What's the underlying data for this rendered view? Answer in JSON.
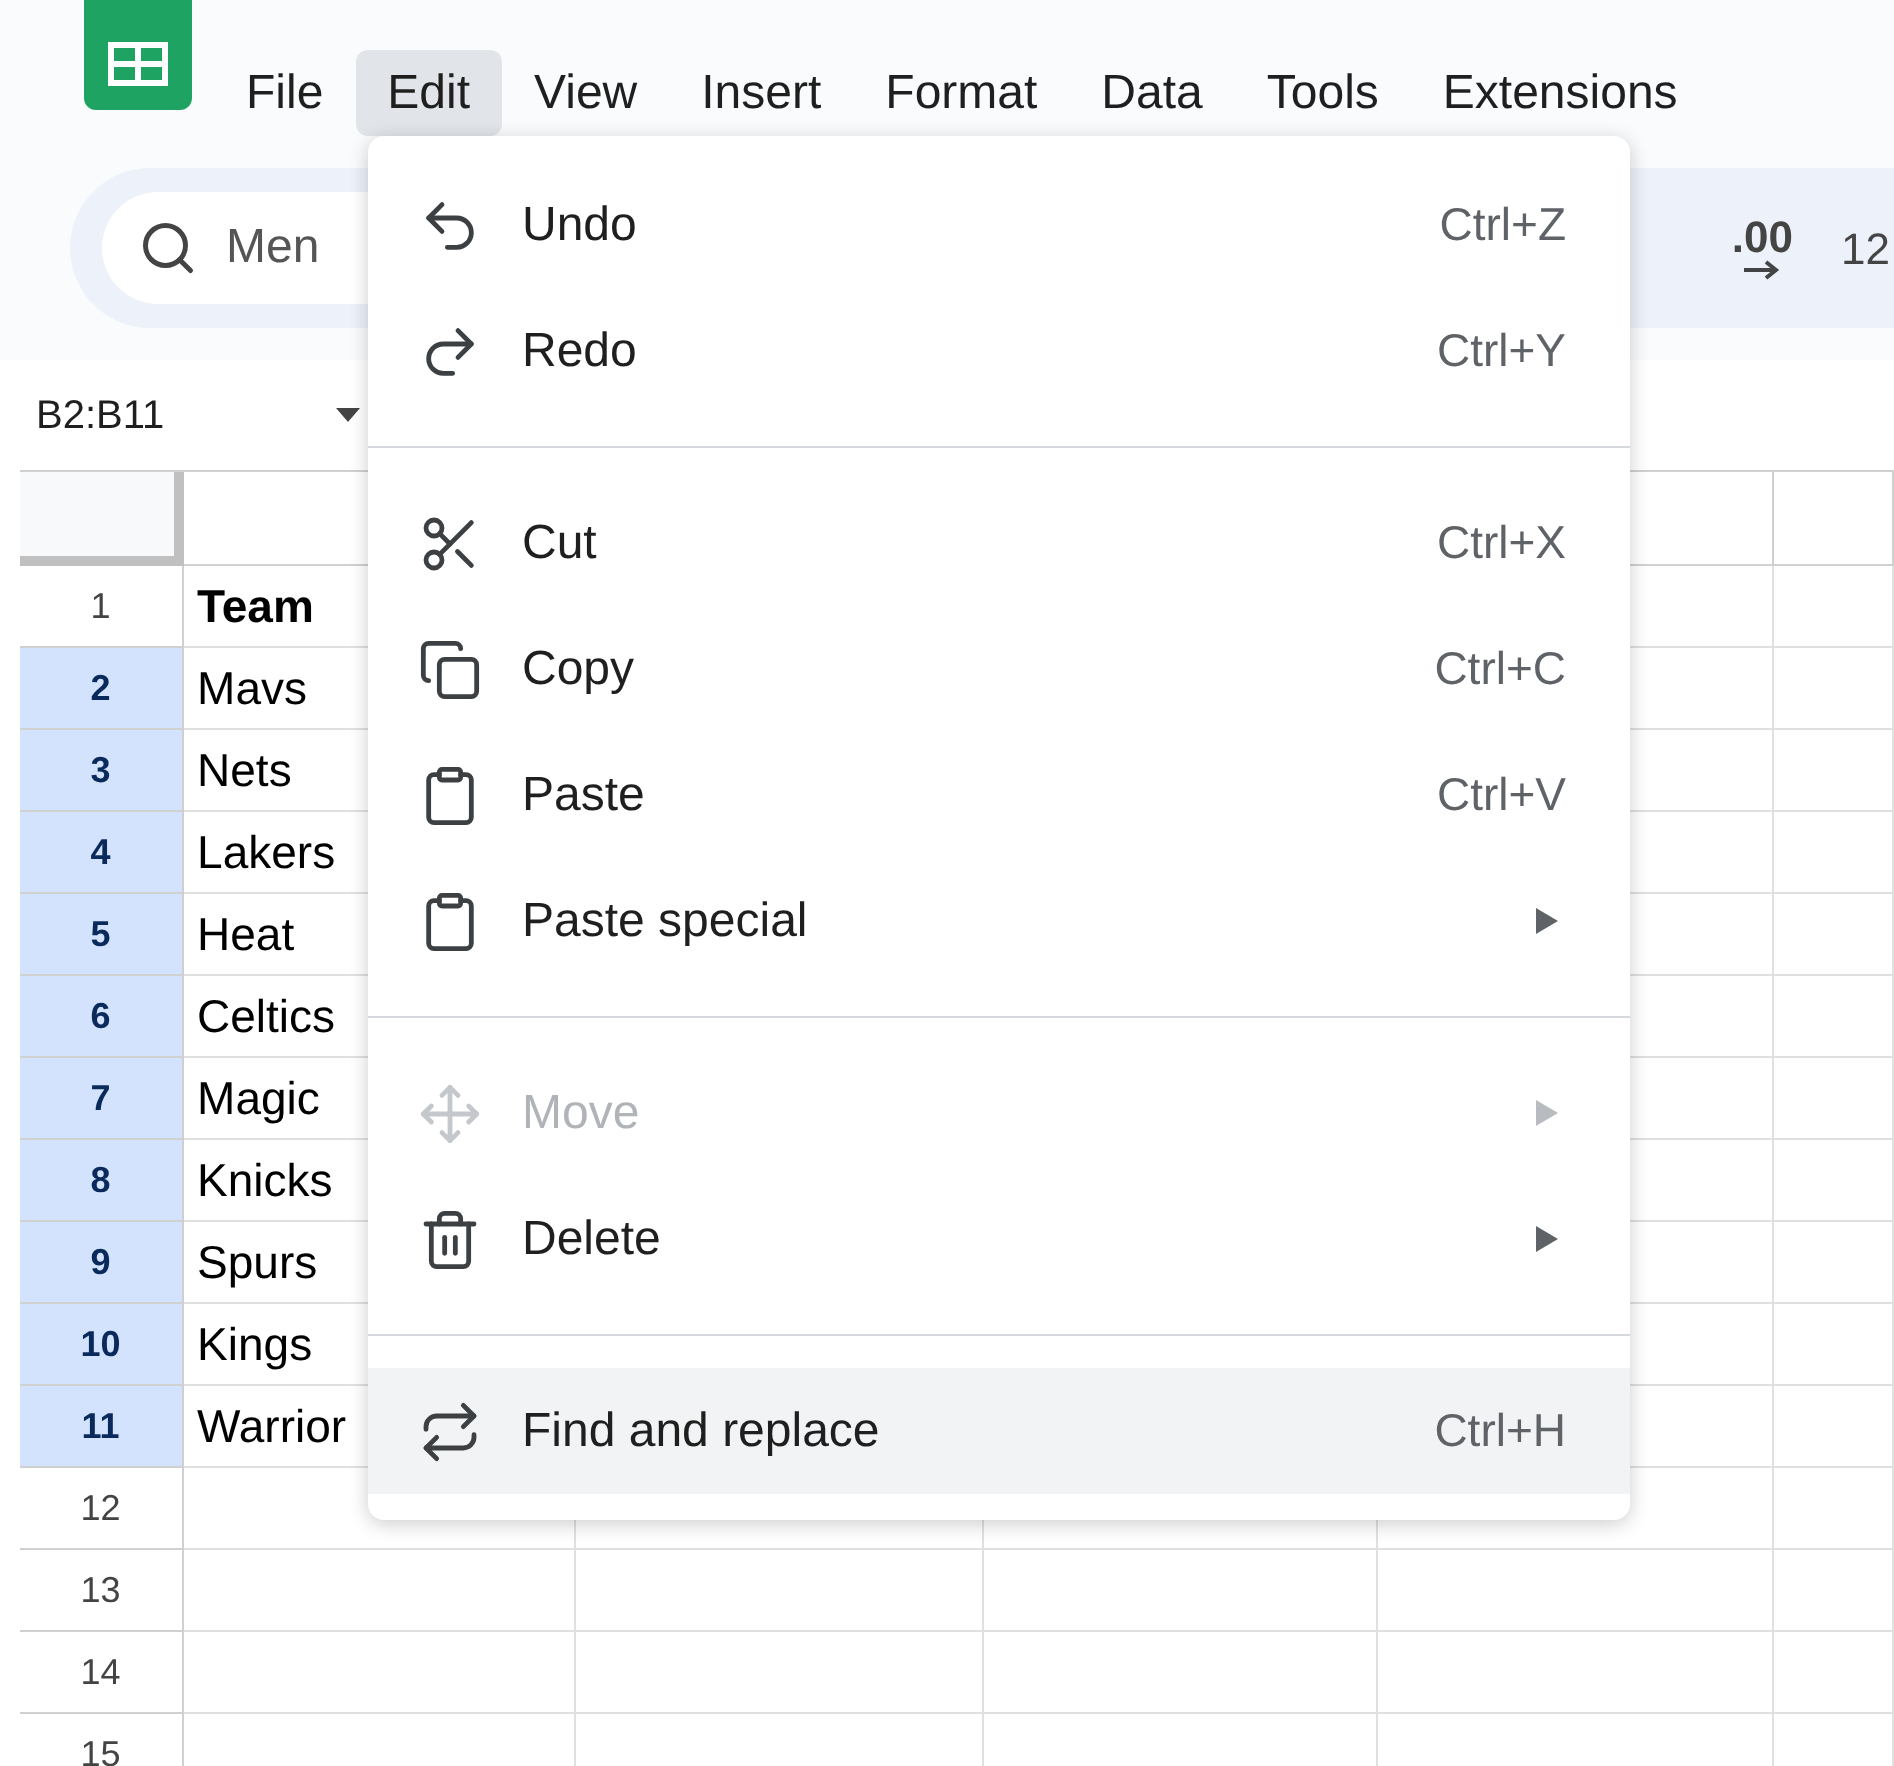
{
  "menu_bar": [
    {
      "label": "File",
      "selected": false
    },
    {
      "label": "Edit",
      "selected": true
    },
    {
      "label": "View",
      "selected": false
    },
    {
      "label": "Insert",
      "selected": false
    },
    {
      "label": "Format",
      "selected": false
    },
    {
      "label": "Data",
      "selected": false
    },
    {
      "label": "Tools",
      "selected": false
    },
    {
      "label": "Extensions",
      "selected": false
    }
  ],
  "toolbar": {
    "search_placeholder": "Men",
    "decimal_icon": ".00",
    "format_partial": "12"
  },
  "name_box": "B2:B11",
  "rows": [
    {
      "number": "1",
      "selected": false,
      "cell": "Team",
      "bold": true
    },
    {
      "number": "2",
      "selected": true,
      "cell": "Mavs",
      "bold": false
    },
    {
      "number": "3",
      "selected": true,
      "cell": "Nets",
      "bold": false
    },
    {
      "number": "4",
      "selected": true,
      "cell": "Lakers",
      "bold": false
    },
    {
      "number": "5",
      "selected": true,
      "cell": "Heat",
      "bold": false
    },
    {
      "number": "6",
      "selected": true,
      "cell": "Celtics",
      "bold": false
    },
    {
      "number": "7",
      "selected": true,
      "cell": "Magic",
      "bold": false
    },
    {
      "number": "8",
      "selected": true,
      "cell": "Knicks",
      "bold": false
    },
    {
      "number": "9",
      "selected": true,
      "cell": "Spurs",
      "bold": false
    },
    {
      "number": "10",
      "selected": true,
      "cell": "Kings",
      "bold": false
    },
    {
      "number": "11",
      "selected": true,
      "cell": "Warrior",
      "bold": false
    },
    {
      "number": "12",
      "selected": false
    },
    {
      "number": "13",
      "selected": false
    },
    {
      "number": "14",
      "selected": false
    },
    {
      "number": "15",
      "selected": false
    }
  ],
  "edit_menu": {
    "groups": [
      [
        {
          "label": "Undo",
          "shortcut": "Ctrl+Z",
          "submenu": false,
          "disabled": false,
          "selected": false
        },
        {
          "label": "Redo",
          "shortcut": "Ctrl+Y",
          "submenu": false,
          "disabled": false,
          "selected": false
        }
      ],
      [
        {
          "label": "Cut",
          "shortcut": "Ctrl+X",
          "submenu": false,
          "disabled": false,
          "selected": false
        },
        {
          "label": "Copy",
          "shortcut": "Ctrl+C",
          "submenu": false,
          "disabled": false,
          "selected": false
        },
        {
          "label": "Paste",
          "shortcut": "Ctrl+V",
          "submenu": false,
          "disabled": false,
          "selected": false
        },
        {
          "label": "Paste special",
          "submenu": true,
          "disabled": false,
          "selected": false
        }
      ],
      [
        {
          "label": "Move",
          "submenu": true,
          "disabled": true,
          "selected": false
        },
        {
          "label": "Delete",
          "submenu": true,
          "disabled": false,
          "selected": false
        }
      ],
      [
        {
          "label": "Find and replace",
          "shortcut": "Ctrl+H",
          "submenu": false,
          "disabled": false,
          "selected": true
        }
      ]
    ]
  }
}
